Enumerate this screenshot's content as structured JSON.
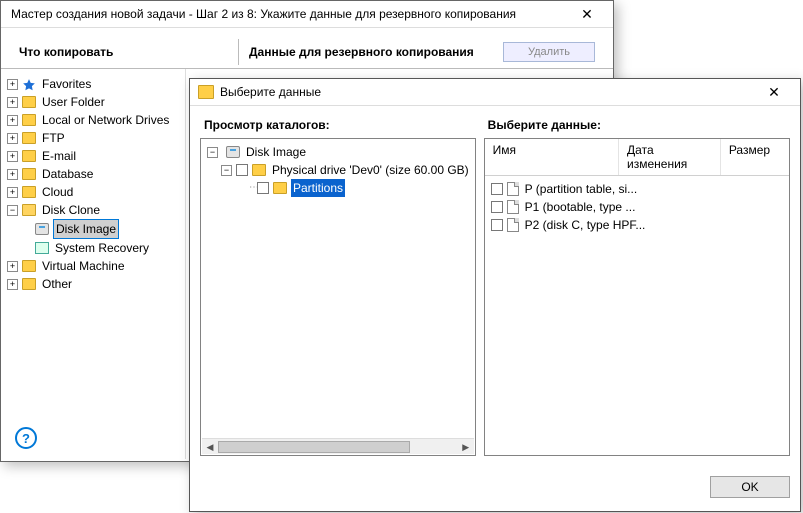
{
  "bgWindow": {
    "title": "Мастер создания новой задачи - Шаг 2 из 8: Укажите данные для резервного копирования",
    "tabLeft": "Что копировать",
    "tabRight": "Данные для резервного копирования",
    "deleteBtn": "Удалить",
    "tree": {
      "favorites": "Favorites",
      "userFolder": "User Folder",
      "localDrives": "Local or Network Drives",
      "ftp": "FTP",
      "email": "E-mail",
      "database": "Database",
      "cloud": "Cloud",
      "diskClone": "Disk Clone",
      "diskImage": "Disk Image",
      "systemRecovery": "System Recovery",
      "virtualMachine": "Virtual Machine",
      "other": "Other"
    }
  },
  "frontWindow": {
    "title": "Выберите данные",
    "leftHdr": "Просмотр каталогов:",
    "rightHdr": "Выберите данные:",
    "okBtn": "OK",
    "tree": {
      "root": "Disk Image",
      "drive": "Physical drive 'Dev0' (size 60.00 GB)",
      "partitions": "Partitions"
    },
    "list": {
      "colName": "Имя",
      "colDate": "Дата изменения",
      "colSize": "Размер",
      "rows": [
        "P (partition table, si...",
        "P1 (bootable, type ...",
        "P2 (disk C, type HPF..."
      ]
    }
  }
}
